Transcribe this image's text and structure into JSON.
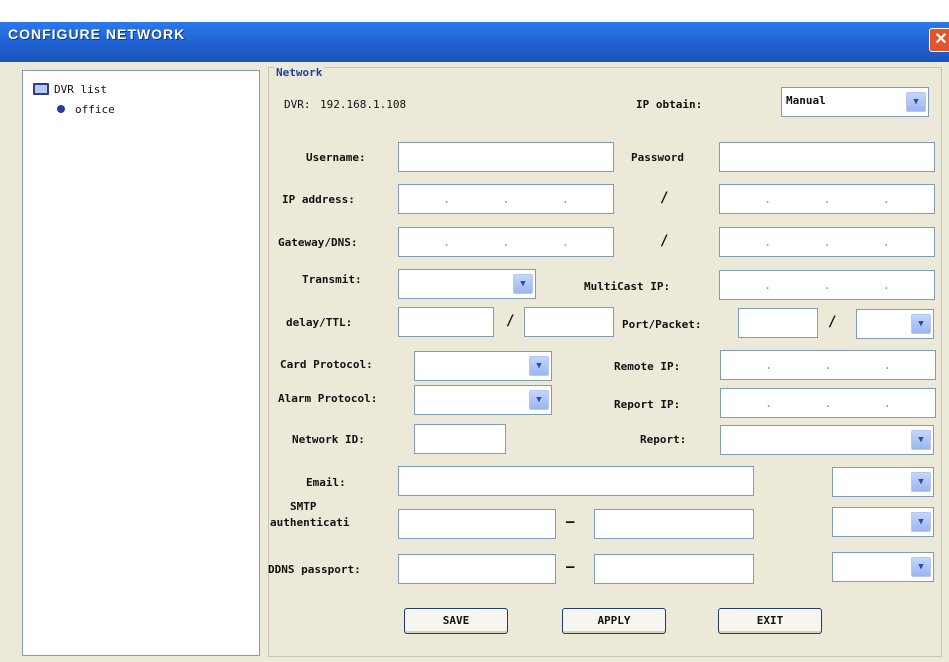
{
  "window": {
    "title": "CONFIGURE NETWORK",
    "close_glyph": "✕"
  },
  "tree": {
    "root_label": "DVR list",
    "items": [
      {
        "label": "office"
      }
    ]
  },
  "network": {
    "group_label": "Network",
    "dvr_label": "DVR:",
    "dvr_value": "192.168.1.108",
    "ip_obtain_label": "IP obtain:",
    "ip_obtain_value": "Manual",
    "username_label": "Username:",
    "username_value": "",
    "password_label": "Password",
    "password_value": "",
    "ip_address_label": "IP address:",
    "gateway_dns_label": "Gateway/DNS:",
    "slash": "/",
    "ip_dots": ".",
    "transmit_label": "Transmit:",
    "transmit_value": "",
    "multicast_ip_label": "MultiCast IP:",
    "delay_ttl_label": "delay/TTL:",
    "port_packet_label": "Port/Packet:",
    "card_protocol_label": "Card Protocol:",
    "remote_ip_label": "Remote IP:",
    "alarm_protocol_label": "Alarm Protocol:",
    "report_ip_label": "Report IP:",
    "network_id_label": "Network ID:",
    "report_label": "Report:",
    "email_label": "Email:",
    "smtp_label_line1": "SMTP",
    "smtp_label_line2": "authenticati",
    "ddns_label": "DDNS passport:",
    "dash": "—"
  },
  "buttons": {
    "save": "SAVE",
    "apply": "APPLY",
    "exit": "EXIT"
  },
  "colors": {
    "titlebar": "#2f7df0",
    "accent_blue": "#1d43a5",
    "close_red": "#e2552a"
  },
  "icons": {
    "tree_root": "computer-icon",
    "tree_node": "bullet-dot-icon",
    "dropdown": "chevron-down-icon",
    "close": "close-icon"
  }
}
